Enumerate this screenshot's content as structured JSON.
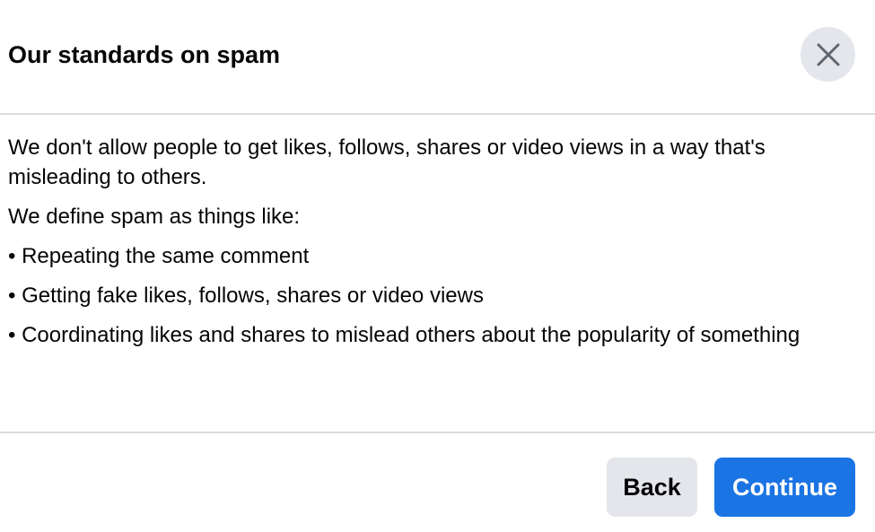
{
  "dialog": {
    "title": "Our standards on spam",
    "close_icon": "close-icon",
    "body": {
      "intro": "We don't allow people to get likes, follows, shares or video views in a way that's misleading to others.",
      "definition": "We define spam as things like:",
      "bullets": [
        "• Repeating the same comment",
        "• Getting fake likes, follows, shares or video views",
        "• Coordinating likes and shares to mislead others about the popularity of something"
      ]
    },
    "footer": {
      "back_label": "Back",
      "continue_label": "Continue"
    }
  },
  "colors": {
    "primary": "#1b74e4",
    "secondary_button": "#e4e6eb",
    "divider": "#dadde1",
    "text": "#050505"
  }
}
